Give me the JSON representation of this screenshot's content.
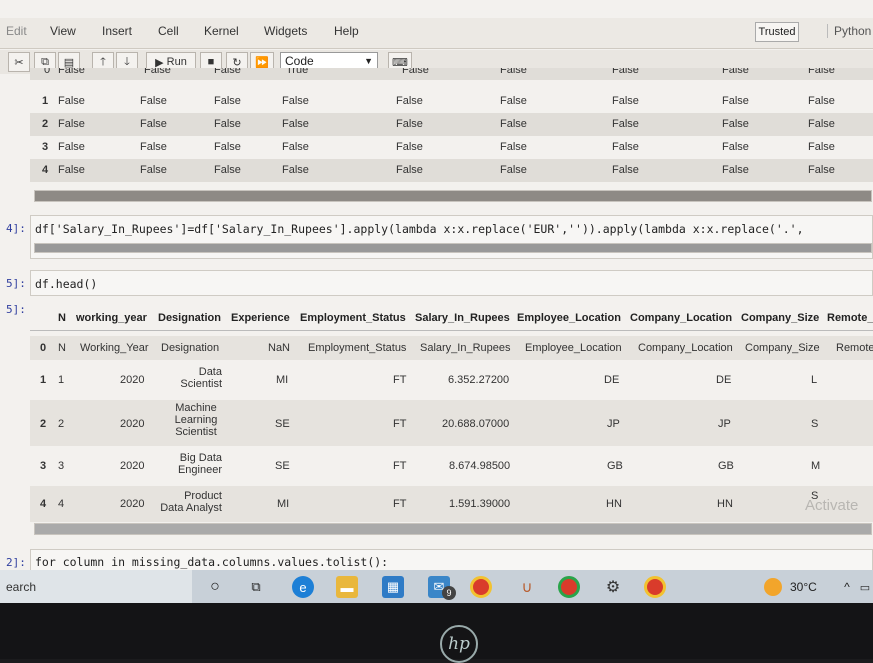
{
  "menubar": {
    "items": [
      "Edit",
      "View",
      "Insert",
      "Cell",
      "Kernel",
      "Widgets",
      "Help"
    ],
    "trusted": "Trusted",
    "kernel": "Python"
  },
  "toolbar": {
    "run_label": "Run",
    "cell_type": "Code"
  },
  "top_table": {
    "cut_row": [
      "0",
      "False",
      "False",
      "False",
      "True",
      "False",
      "False",
      "False",
      "False",
      "False"
    ],
    "rows": [
      [
        "1",
        "False",
        "False",
        "False",
        "False",
        "False",
        "False",
        "False",
        "False",
        "False"
      ],
      [
        "2",
        "False",
        "False",
        "False",
        "False",
        "False",
        "False",
        "False",
        "False",
        "False"
      ],
      [
        "3",
        "False",
        "False",
        "False",
        "False",
        "False",
        "False",
        "False",
        "False",
        "False"
      ],
      [
        "4",
        "False",
        "False",
        "False",
        "False",
        "False",
        "False",
        "False",
        "False",
        "False"
      ]
    ]
  },
  "cells": {
    "c1_prompt": "4]:",
    "c1_code": "df['Salary_In_Rupees']=df['Salary_In_Rupees'].apply(lambda x:x.replace('EUR','')).apply(lambda x:x.replace('.',",
    "c2_prompt": "5]:",
    "c2_code": "df.head()",
    "c2_out_prompt": "5]:",
    "c3_prompt": "2]:",
    "c3_code": "for column in missing_data.columns.values.tolist():"
  },
  "dataframe": {
    "columns": [
      "",
      "N",
      "working_year",
      "Designation",
      "Experience",
      "Employment_Status",
      "Salary_In_Rupees",
      "Employee_Location",
      "Company_Location",
      "Company_Size",
      "Remote_"
    ],
    "rows": [
      [
        "0",
        "N",
        "Working_Year",
        "Designation",
        "NaN",
        "Employment_Status",
        "Salary_In_Rupees",
        "Employee_Location",
        "Company_Location",
        "Company_Size",
        "Remote"
      ],
      [
        "1",
        "1",
        "2020",
        "Data Scientist",
        "MI",
        "FT",
        "6.352.27200",
        "DE",
        "DE",
        "L",
        ""
      ],
      [
        "2",
        "2",
        "2020",
        "Machine Learning Scientist",
        "SE",
        "FT",
        "20.688.07000",
        "JP",
        "JP",
        "S",
        ""
      ],
      [
        "3",
        "3",
        "2020",
        "Big Data Engineer",
        "SE",
        "FT",
        "8.674.98500",
        "GB",
        "GB",
        "M",
        ""
      ],
      [
        "4",
        "4",
        "2020",
        "Product Data Analyst",
        "MI",
        "FT",
        "1.591.39000",
        "HN",
        "HN",
        "S",
        ""
      ]
    ]
  },
  "watermark": "Activate",
  "taskbar": {
    "search": "earch",
    "temperature": "30°C",
    "mail_badge": "9"
  },
  "logo": "hp"
}
